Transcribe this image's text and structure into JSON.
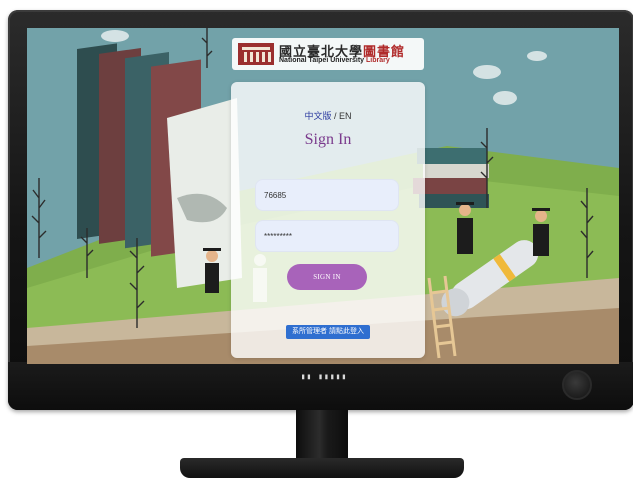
{
  "logo": {
    "cn_part1": "國立臺北大學",
    "cn_part2": "圖書館",
    "en_part1": "National Taipei University",
    "en_part2": "Library"
  },
  "language": {
    "cn": "中文版",
    "separator": "/",
    "en": "EN"
  },
  "login": {
    "title": "Sign In",
    "username_value": "76685",
    "password_value": "*********",
    "submit_label": "SIGN IN",
    "admin_link": "系所管理者 請點此登入"
  },
  "monitor": {
    "brand": "▮▮ ▮▮▮▮▮"
  },
  "colors": {
    "sky": "#6f9ea6",
    "accent_purple": "#a863ba",
    "title_purple": "#7a3a8c",
    "link_blue": "#2f6fd0"
  }
}
